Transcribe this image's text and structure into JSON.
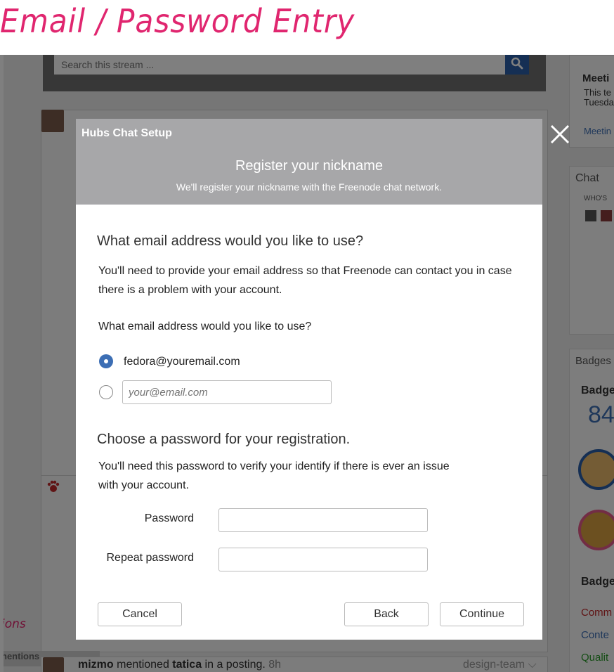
{
  "page_title": "Email / Password Entry",
  "background": {
    "search_placeholder": "Search this stream ...",
    "right": {
      "meeting_title": "Meeti",
      "meeting_line1": "This te",
      "meeting_line2": "Tuesda",
      "meeting_link": "Meetin",
      "chat_title": "Chat",
      "whos_label": "WHO'S",
      "badges_title": "Badges",
      "badges_sub": "Badge",
      "badges_count": "84",
      "badges_sub2": "Badge",
      "list": [
        "Comm",
        "Conte",
        "Qualit"
      ]
    },
    "feed": {
      "left_note": "ions",
      "left_tab": "nentions",
      "author": "mizmo",
      "action": "mentioned",
      "target": "tatica",
      "rest": "in a posting.",
      "time": "8h",
      "group": "design-team"
    }
  },
  "modal": {
    "app_title": "Hubs Chat Setup",
    "heading": "Register your nickname",
    "subheading": "We'll register your nickname with the Freenode chat network.",
    "email_section_title": "What email address would you like to use?",
    "email_description": "You'll need to provide your email address so that Freenode can contact you in case there is a problem with your account.",
    "email_question": "What email address would you like to use?",
    "email_option_default": "fedora@youremail.com",
    "email_placeholder": "your@email.com",
    "password_section_title": "Choose a password for your registration.",
    "password_description": "You'll need this password to verify your identify if there is ever an issue with your account.",
    "password_label": "Password",
    "repeat_password_label": "Repeat password",
    "cancel_label": "Cancel",
    "back_label": "Back",
    "continue_label": "Continue"
  },
  "icons": {
    "close": "close-icon",
    "search": "search-icon"
  },
  "colors": {
    "accent": "#3c6eb4",
    "annotation": "#e0266f",
    "modal_header": "#a7a7a9"
  }
}
